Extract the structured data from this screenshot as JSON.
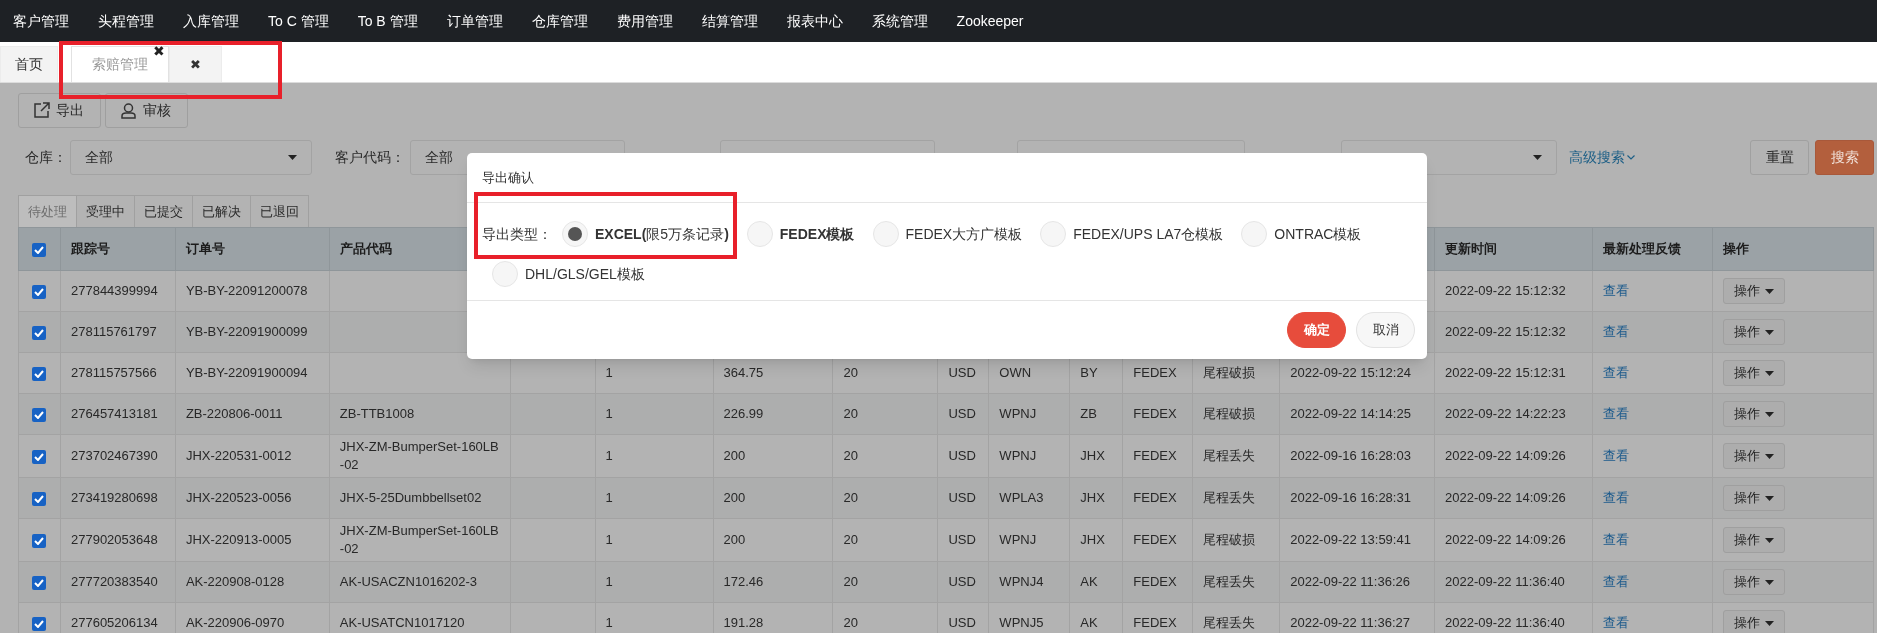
{
  "nav_menu": [
    "客户管理",
    "头程管理",
    "入库管理",
    "To C 管理",
    "To B 管理",
    "订单管理",
    "仓库管理",
    "费用管理",
    "结算管理",
    "报表中心",
    "系统管理",
    "Zookeeper"
  ],
  "page_tabs": [
    {
      "label": "首页",
      "selected": false
    },
    {
      "label": "索赔管理",
      "selected": true,
      "close": "✖"
    },
    {
      "close": "✖",
      "selected": false
    }
  ],
  "toolbar": [
    {
      "label": "导出",
      "kind": "export"
    },
    {
      "label": "审核",
      "kind": "audit"
    }
  ],
  "filters": [
    {
      "kind": "select",
      "label": "仓库：",
      "value": "全部"
    },
    {
      "kind": "select",
      "label": "客户代码：",
      "value": "全部"
    },
    {
      "kind": "input"
    },
    {
      "kind": "input"
    },
    {
      "kind": "select"
    }
  ],
  "advanced_search": "高级搜索",
  "filter_buttons": [
    {
      "label": "重置",
      "kind": "default"
    },
    {
      "label": "搜索",
      "kind": "primary"
    }
  ],
  "status_tabs": [
    {
      "label": "待处理",
      "selected": true
    },
    {
      "label": "受理中",
      "selected": false
    },
    {
      "label": "已提交",
      "selected": false
    },
    {
      "label": "已解决",
      "selected": false
    },
    {
      "label": "已退回",
      "selected": false
    }
  ],
  "table": {
    "all_checked": true,
    "columns": [
      "跟踪号",
      "订单号",
      "产品代码",
      null,
      null,
      null,
      null,
      null,
      null,
      null,
      null,
      null,
      null,
      "更新时间",
      "最新处理反馈",
      "操作"
    ],
    "rows": [
      {
        "checked": true,
        "cells": [
          "277844399994",
          "YB-BY-22091200078",
          null,
          null,
          null,
          null,
          null,
          null,
          null,
          null,
          null,
          null,
          null,
          "2022-09-22 15:12:32",
          "查看",
          "操作"
        ]
      },
      {
        "checked": true,
        "cells": [
          "278115761797",
          "YB-BY-22091900099",
          null,
          null,
          null,
          null,
          null,
          null,
          null,
          null,
          null,
          null,
          null,
          "2022-09-22 15:12:32",
          "查看",
          "操作"
        ]
      },
      {
        "checked": true,
        "cells": [
          "278115757566",
          "YB-BY-22091900094",
          null,
          null,
          "1",
          "364.75",
          "20",
          "USD",
          "OWN",
          "BY",
          "FEDEX",
          "尾程破损",
          "2022-09-22 15:12:24",
          "2022-09-22 15:12:31",
          "查看",
          "操作"
        ]
      },
      {
        "checked": true,
        "cells": [
          "276457413181",
          "ZB-220806-0011",
          "ZB-TTB1008",
          null,
          "1",
          "226.99",
          "20",
          "USD",
          "WPNJ",
          "ZB",
          "FEDEX",
          "尾程破损",
          "2022-09-22 14:14:25",
          "2022-09-22 14:22:23",
          "查看",
          "操作"
        ]
      },
      {
        "checked": true,
        "cells": [
          "273702467390",
          "JHX-220531-0012",
          "JHX-ZM-BumperSet-160LB-02",
          null,
          "1",
          "200",
          "20",
          "USD",
          "WPNJ",
          "JHX",
          "FEDEX",
          "尾程丢失",
          "2022-09-16 16:28:03",
          "2022-09-22 14:09:26",
          "查看",
          "操作"
        ]
      },
      {
        "checked": true,
        "cells": [
          "273419280698",
          "JHX-220523-0056",
          "JHX-5-25Dumbbellset02",
          null,
          "1",
          "200",
          "20",
          "USD",
          "WPLA3",
          "JHX",
          "FEDEX",
          "尾程丢失",
          "2022-09-16 16:28:31",
          "2022-09-22 14:09:26",
          "查看",
          "操作"
        ]
      },
      {
        "checked": true,
        "cells": [
          "277902053648",
          "JHX-220913-0005",
          "JHX-ZM-BumperSet-160LB-02",
          null,
          "1",
          "200",
          "20",
          "USD",
          "WPNJ",
          "JHX",
          "FEDEX",
          "尾程破损",
          "2022-09-22 13:59:41",
          "2022-09-22 14:09:26",
          "查看",
          "操作"
        ]
      },
      {
        "checked": true,
        "cells": [
          "277720383540",
          "AK-220908-0128",
          "AK-USACZN1016202-3",
          null,
          "1",
          "172.46",
          "20",
          "USD",
          "WPNJ4",
          "AK",
          "FEDEX",
          "尾程丢失",
          "2022-09-22 11:36:26",
          "2022-09-22 11:36:40",
          "查看",
          "操作"
        ]
      },
      {
        "checked": true,
        "cells": [
          "277605206134",
          "AK-220906-0970",
          "AK-USATCN1017120",
          null,
          "1",
          "191.28",
          "20",
          "USD",
          "WPNJ5",
          "AK",
          "FEDEX",
          "尾程丢失",
          "2022-09-22 11:36:27",
          "2022-09-22 11:36:40",
          "查看",
          "操作"
        ]
      }
    ]
  },
  "export_dialog": {
    "title": "导出确认",
    "field_label": "导出类型：",
    "options": [
      {
        "label": "**EXCEL(**限5万条记录**)**",
        "selected": true,
        "bold": false
      },
      {
        "label": "FEDEX模板",
        "selected": false,
        "bold": true
      },
      {
        "label": "FEDEX大方广模板",
        "selected": false,
        "bold": false
      },
      {
        "label": "FEDEX/UPS LA7仓模板",
        "selected": false,
        "bold": false
      },
      {
        "label": "ONTRAC模板",
        "selected": false,
        "bold": false
      },
      {
        "label": "DHL/GLS/GEL模板",
        "selected": false,
        "bold": false
      }
    ],
    "buttons": [
      {
        "label": "确定",
        "kind": "primary"
      },
      {
        "label": "取消",
        "kind": "default"
      }
    ]
  }
}
